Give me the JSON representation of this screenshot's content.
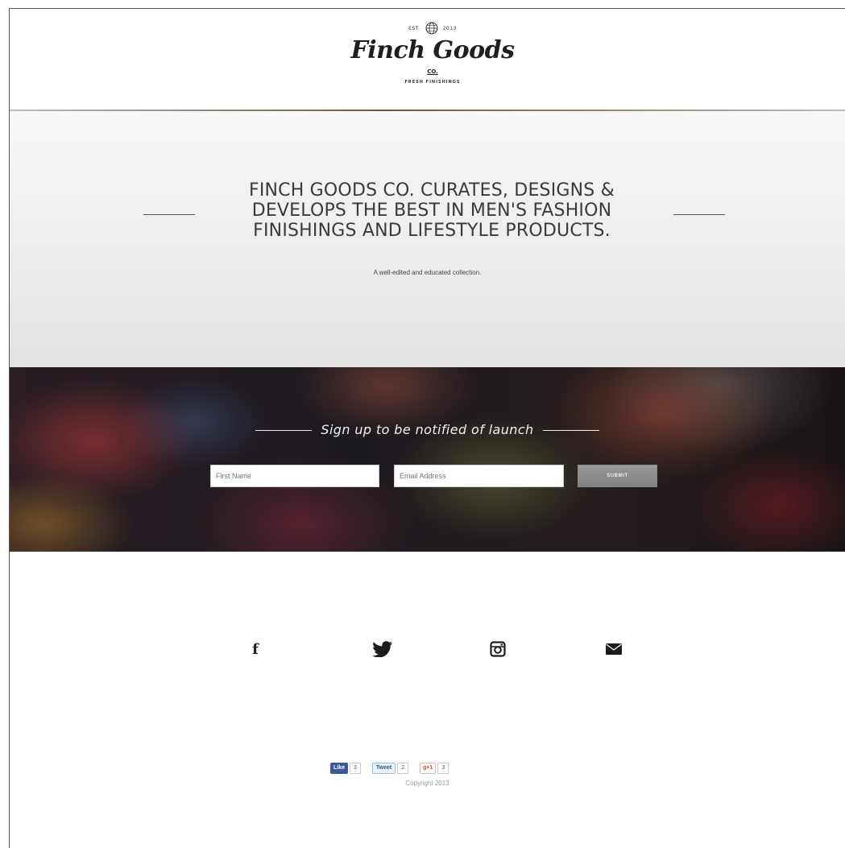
{
  "header": {
    "logo": {
      "small_left": "EST.",
      "small_right": "2013",
      "name": "Finch Goods",
      "co": "CO.",
      "tagline": "FRESH FINISHINGS"
    }
  },
  "hero": {
    "title": "FINCH GOODS CO. CURATES, DESIGNS & DEVELOPS THE BEST IN MEN'S FASHION FINISHINGS AND LIFESTYLE PRODUCTS.",
    "subtitle": "A well-edited and educated collection."
  },
  "signup": {
    "heading": "Sign up to be notified of launch",
    "first_name_placeholder": "First Name",
    "email_placeholder": "Email Address",
    "submit_label": "SUBMIT"
  },
  "social": {
    "icons": [
      "facebook-icon",
      "twitter-icon",
      "instagram-icon",
      "mail-icon"
    ],
    "facebook_glyph": "f"
  },
  "share": {
    "like_label": "Like",
    "like_count": "3",
    "tweet_label": "Tweet",
    "tweet_count": "2",
    "gplus_label": "g+1",
    "gplus_count": "3"
  },
  "footer": {
    "copyright": "Copyright 2013"
  },
  "colors": {
    "facebook": "#3b5998",
    "gplus": "#dd4b39",
    "submit": "#8a8a8a"
  }
}
